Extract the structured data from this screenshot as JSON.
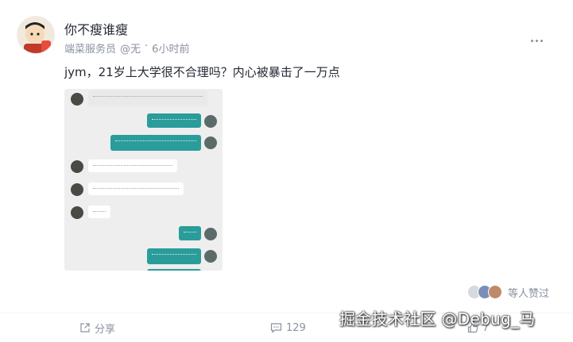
{
  "author": {
    "name": "你不瘦谁瘦",
    "role": "端菜服务员",
    "handle": "@无",
    "time": "6小时前"
  },
  "post": {
    "text": "jym，21岁上大学很不合理吗？内心被暴击了一万点"
  },
  "likes": {
    "label": "等人赞过"
  },
  "actions": {
    "share": "分享",
    "comments": "129",
    "like_count": "7"
  },
  "watermark": "掘金技术社区 @Debug_马",
  "icons": [
    "more-icon",
    "share-icon",
    "comment-icon",
    "like-icon"
  ],
  "colors": {
    "bubble_teal": "#2a9d9a",
    "meta_gray": "#8a919f",
    "text": "#252933"
  }
}
